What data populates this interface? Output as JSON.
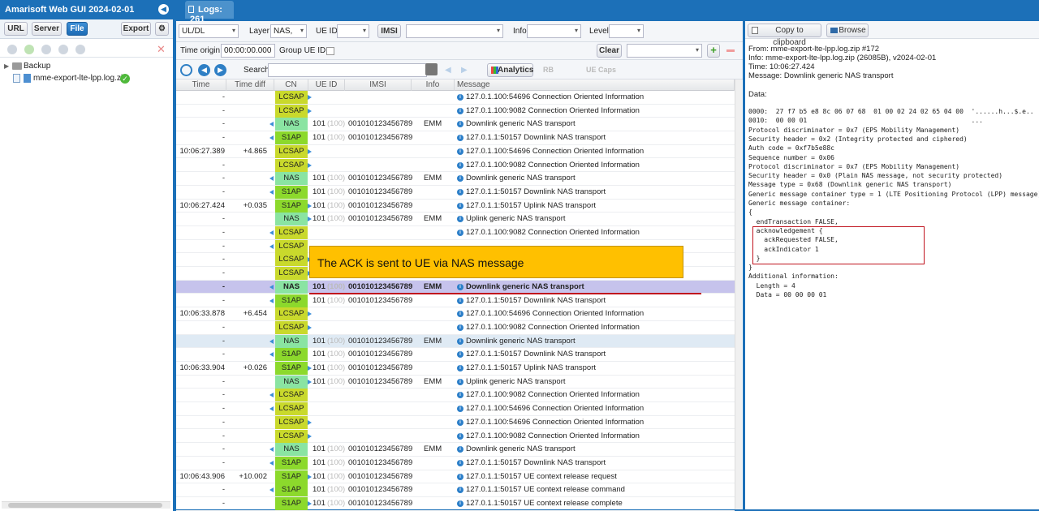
{
  "app": {
    "title": "Amarisoft Web GUI 2024-02-01"
  },
  "left": {
    "buttons": {
      "url": "URL",
      "server": "Server",
      "file": "File",
      "export": "Export"
    },
    "tree": [
      {
        "label": "Backup"
      },
      {
        "label": "mme-export-lte-lpp.log.zip"
      }
    ]
  },
  "tab": {
    "label": "Logs: 261"
  },
  "filters": {
    "uldl": "UL/DL",
    "layer_label": "Layer",
    "layer_value": "NAS,",
    "ueid_label": "UE ID",
    "imsi_btn": "IMSI",
    "info_label": "Info",
    "level_label": "Level",
    "time_origin_label": "Time origin:",
    "time_origin_value": "00:00:00.000",
    "group_ueid_label": "Group UE ID:",
    "clear_btn": "Clear",
    "search_label": "Search",
    "analytics": "Analytics",
    "rb": "RB",
    "ue_caps": "UE Caps"
  },
  "columns": [
    "Time",
    "Time diff",
    "CN",
    "UE ID",
    "IMSI",
    "Info",
    "Message"
  ],
  "rows": [
    {
      "time": "-",
      "diff": "",
      "cn": "LCSAP",
      "dir": "r",
      "ue": "",
      "imsi": "",
      "info": "",
      "msg": "127.0.1.100:54696 Connection Oriented Information"
    },
    {
      "time": "-",
      "diff": "",
      "cn": "LCSAP",
      "dir": "r",
      "ue": "",
      "imsi": "",
      "info": "",
      "msg": "127.0.1.100:9082 Connection Oriented Information"
    },
    {
      "time": "-",
      "diff": "",
      "cn": "NAS",
      "dir": "l",
      "ue": "101",
      "imsi": "001010123456789",
      "info": "EMM",
      "msg": "Downlink generic NAS transport"
    },
    {
      "time": "-",
      "diff": "",
      "cn": "S1AP",
      "dir": "l",
      "ue": "101",
      "imsi": "001010123456789",
      "info": "",
      "msg": "127.0.1.1:50157 Downlink NAS transport"
    },
    {
      "time": "10:06:27.389",
      "diff": "+4.865",
      "cn": "LCSAP",
      "dir": "r",
      "ue": "",
      "imsi": "",
      "info": "",
      "msg": "127.0.1.100:54696 Connection Oriented Information"
    },
    {
      "time": "-",
      "diff": "",
      "cn": "LCSAP",
      "dir": "r",
      "ue": "",
      "imsi": "",
      "info": "",
      "msg": "127.0.1.100:9082 Connection Oriented Information"
    },
    {
      "time": "-",
      "diff": "",
      "cn": "NAS",
      "dir": "l",
      "ue": "101",
      "imsi": "001010123456789",
      "info": "EMM",
      "msg": "Downlink generic NAS transport"
    },
    {
      "time": "-",
      "diff": "",
      "cn": "S1AP",
      "dir": "l",
      "ue": "101",
      "imsi": "001010123456789",
      "info": "",
      "msg": "127.0.1.1:50157 Downlink NAS transport"
    },
    {
      "time": "10:06:27.424",
      "diff": "+0.035",
      "cn": "S1AP",
      "dir": "r",
      "ue": "101",
      "imsi": "001010123456789",
      "info": "",
      "msg": "127.0.1.1:50157 Uplink NAS transport"
    },
    {
      "time": "-",
      "diff": "",
      "cn": "NAS",
      "dir": "r",
      "ue": "101",
      "imsi": "001010123456789",
      "info": "EMM",
      "msg": "Uplink generic NAS transport"
    },
    {
      "time": "-",
      "diff": "",
      "cn": "LCSAP",
      "dir": "l",
      "ue": "",
      "imsi": "",
      "info": "",
      "msg": "127.0.1.100:9082 Connection Oriented Information"
    },
    {
      "time": "-",
      "diff": "",
      "cn": "LCSAP",
      "dir": "l",
      "ue": "",
      "imsi": "",
      "info": "",
      "msg": ""
    },
    {
      "time": "-",
      "diff": "",
      "cn": "LCSAP",
      "dir": "r",
      "ue": "",
      "imsi": "",
      "info": "",
      "msg": ""
    },
    {
      "time": "-",
      "diff": "",
      "cn": "LCSAP",
      "dir": "r",
      "ue": "",
      "imsi": "",
      "info": "",
      "msg": ""
    },
    {
      "time": "-",
      "diff": "",
      "cn": "NAS",
      "dir": "l",
      "ue": "101",
      "imsi": "001010123456789",
      "info": "EMM",
      "msg": "Downlink generic NAS transport",
      "hl": true
    },
    {
      "time": "-",
      "diff": "",
      "cn": "S1AP",
      "dir": "l",
      "ue": "101",
      "imsi": "001010123456789",
      "info": "",
      "msg": "127.0.1.1:50157 Downlink NAS transport"
    },
    {
      "time": "10:06:33.878",
      "diff": "+6.454",
      "cn": "LCSAP",
      "dir": "r",
      "ue": "",
      "imsi": "",
      "info": "",
      "msg": "127.0.1.100:54696 Connection Oriented Information"
    },
    {
      "time": "-",
      "diff": "",
      "cn": "LCSAP",
      "dir": "r",
      "ue": "",
      "imsi": "",
      "info": "",
      "msg": "127.0.1.100:9082 Connection Oriented Information"
    },
    {
      "time": "-",
      "diff": "",
      "cn": "NAS",
      "dir": "l",
      "ue": "101",
      "imsi": "001010123456789",
      "info": "EMM",
      "msg": "Downlink generic NAS transport",
      "hl2": true
    },
    {
      "time": "-",
      "diff": "",
      "cn": "S1AP",
      "dir": "l",
      "ue": "101",
      "imsi": "001010123456789",
      "info": "",
      "msg": "127.0.1.1:50157 Downlink NAS transport"
    },
    {
      "time": "10:06:33.904",
      "diff": "+0.026",
      "cn": "S1AP",
      "dir": "r",
      "ue": "101",
      "imsi": "001010123456789",
      "info": "",
      "msg": "127.0.1.1:50157 Uplink NAS transport"
    },
    {
      "time": "-",
      "diff": "",
      "cn": "NAS",
      "dir": "r",
      "ue": "101",
      "imsi": "001010123456789",
      "info": "EMM",
      "msg": "Uplink generic NAS transport"
    },
    {
      "time": "-",
      "diff": "",
      "cn": "LCSAP",
      "dir": "l",
      "ue": "",
      "imsi": "",
      "info": "",
      "msg": "127.0.1.100:9082 Connection Oriented Information"
    },
    {
      "time": "-",
      "diff": "",
      "cn": "LCSAP",
      "dir": "l",
      "ue": "",
      "imsi": "",
      "info": "",
      "msg": "127.0.1.100:54696 Connection Oriented Information"
    },
    {
      "time": "-",
      "diff": "",
      "cn": "LCSAP",
      "dir": "r",
      "ue": "",
      "imsi": "",
      "info": "",
      "msg": "127.0.1.100:54696 Connection Oriented Information"
    },
    {
      "time": "-",
      "diff": "",
      "cn": "LCSAP",
      "dir": "r",
      "ue": "",
      "imsi": "",
      "info": "",
      "msg": "127.0.1.100:9082 Connection Oriented Information"
    },
    {
      "time": "-",
      "diff": "",
      "cn": "NAS",
      "dir": "l",
      "ue": "101",
      "imsi": "001010123456789",
      "info": "EMM",
      "msg": "Downlink generic NAS transport"
    },
    {
      "time": "-",
      "diff": "",
      "cn": "S1AP",
      "dir": "l",
      "ue": "101",
      "imsi": "001010123456789",
      "info": "",
      "msg": "127.0.1.1:50157 Downlink NAS transport"
    },
    {
      "time": "10:06:43.906",
      "diff": "+10.002",
      "cn": "S1AP",
      "dir": "r",
      "ue": "101",
      "imsi": "001010123456789",
      "info": "",
      "msg": "127.0.1.1:50157 UE context release request"
    },
    {
      "time": "-",
      "diff": "",
      "cn": "S1AP",
      "dir": "l",
      "ue": "101",
      "imsi": "001010123456789",
      "info": "",
      "msg": "127.0.1.1:50157 UE context release command"
    },
    {
      "time": "-",
      "diff": "",
      "cn": "S1AP",
      "dir": "r",
      "ue": "101",
      "imsi": "001010123456789",
      "info": "",
      "msg": "127.0.1.1:50157 UE context release complete"
    }
  ],
  "ue_group": "(100)",
  "callout": "The ACK is sent to UE via NAS message",
  "right": {
    "copy_btn": "Copy to clipboard",
    "browse_btn": "Browse",
    "header": [
      "From: mme-export-lte-lpp.log.zip #172",
      "Info: mme-export-lte-lpp.log.zip (26085B), v2024-02-01",
      "Time: 10:06:27.424",
      "Message: Downlink generic NAS transport"
    ],
    "data_label": "Data:",
    "dump": [
      "0000:  27 f7 b5 e8 8c 06 07 68  01 00 02 24 02 65 04 00  '......h...$.e..",
      "0010:  00 00 01                                          ...",
      "Protocol discriminator = 0x7 (EPS Mobility Management)",
      "Security header = 0x2 (Integrity protected and ciphered)",
      "Auth code = 0xf7b5e88c",
      "Sequence number = 0x06",
      "Protocol discriminator = 0x7 (EPS Mobility Management)",
      "Security header = 0x0 (Plain NAS message, not security protected)",
      "Message type = 0x68 (Downlink generic NAS transport)",
      "Generic message container type = 1 (LTE Positioning Protocol (LPP) message)",
      "Generic message container:",
      "{",
      "  endTransaction FALSE,",
      "  acknowledgement {",
      "    ackRequested FALSE,",
      "    ackIndicator 1",
      "  }",
      "}",
      "Additional information:",
      "  Length = 4",
      "  Data = 00 00 00 01"
    ]
  }
}
